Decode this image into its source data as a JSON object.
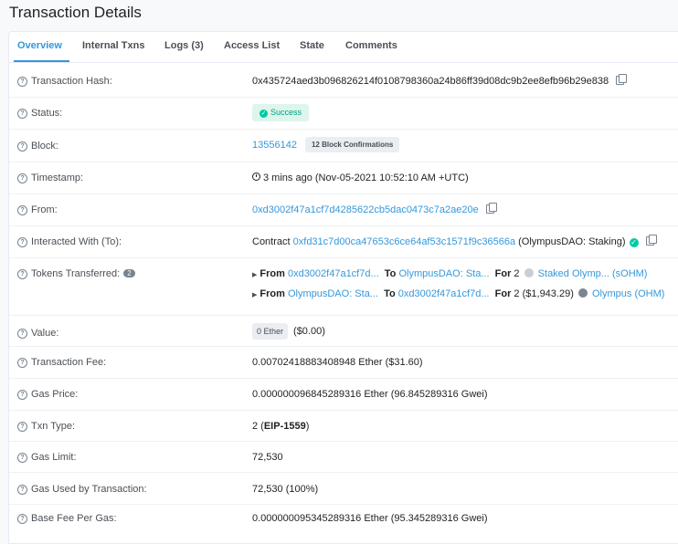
{
  "page_title": "Transaction Details",
  "tabs": [
    "Overview",
    "Internal Txns",
    "Logs (3)",
    "Access List",
    "State",
    "Comments"
  ],
  "rows": {
    "tx_hash": {
      "label": "Transaction Hash:",
      "value": "0x435724aed3b096826214f0108798360a24b86ff39d08dc9b2ee8efb96b29e838"
    },
    "status": {
      "label": "Status:",
      "value": "Success"
    },
    "block": {
      "label": "Block:",
      "value": "13556142",
      "confirmations": "12 Block Confirmations"
    },
    "timestamp": {
      "label": "Timestamp:",
      "value": "3 mins ago (Nov-05-2021 10:52:10 AM +UTC)"
    },
    "from": {
      "label": "From:",
      "value": "0xd3002f47a1cf7d4285622cb5dac0473c7a2ae20e"
    },
    "interacted": {
      "label": "Interacted With (To):",
      "prefix": "Contract",
      "address": "0xfd31c7d00ca47653c6ce64af53c1571f9c36566a",
      "name": "(OlympusDAO: Staking)"
    },
    "tokens": {
      "label": "Tokens Transferred:",
      "count": "2",
      "transfers": [
        {
          "from_kw": "From",
          "from": "0xd3002f47a1cf7d...",
          "to_kw": "To",
          "to": "OlympusDAO: Sta...",
          "for_kw": "For",
          "amount": "2",
          "usd": "",
          "token": "Staked Olymp... (sOHM)"
        },
        {
          "from_kw": "From",
          "from": "OlympusDAO: Sta...",
          "to_kw": "To",
          "to": "0xd3002f47a1cf7d...",
          "for_kw": "For",
          "amount": "2",
          "usd": "($1,943.29)",
          "token": "Olympus (OHM)"
        }
      ]
    },
    "value": {
      "label": "Value:",
      "badge": "0 Ether",
      "usd": "($0.00)"
    },
    "fee": {
      "label": "Transaction Fee:",
      "value": "0.00702418883408948 Ether ($31.60)"
    },
    "gas_price": {
      "label": "Gas Price:",
      "value": "0.000000096845289316 Ether (96.845289316 Gwei)"
    },
    "txn_type": {
      "label": "Txn Type:",
      "prefix": "2 (",
      "bold": "EIP-1559",
      "suffix": ")"
    },
    "gas_limit": {
      "label": "Gas Limit:",
      "value": "72,530"
    },
    "gas_used": {
      "label": "Gas Used by Transaction:",
      "value": "72,530 (100%)"
    },
    "base_fee": {
      "label": "Base Fee Per Gas:",
      "value": "0.000000095345289316 Ether (95.345289316 Gwei)"
    }
  },
  "colors": {
    "link": "#3498db",
    "success_bg": "#def5ec",
    "success_text": "#00a186",
    "verified": "#00c9a7"
  }
}
